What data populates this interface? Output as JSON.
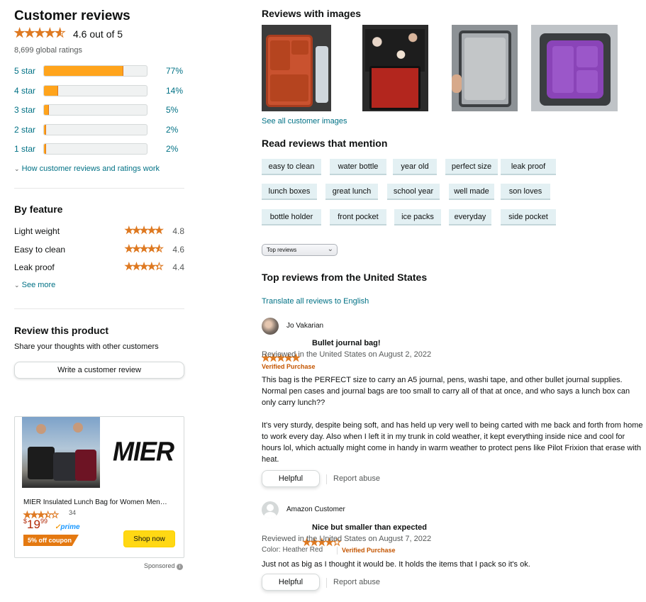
{
  "summary": {
    "title": "Customer reviews",
    "rating_text": "4.6 out of 5",
    "rating_value": 4.6,
    "global_ratings": "8,699 global ratings",
    "histogram": [
      {
        "label": "5 star",
        "percent_text": "77%",
        "percent": 77
      },
      {
        "label": "4 star",
        "percent_text": "14%",
        "percent": 14
      },
      {
        "label": "3 star",
        "percent_text": "5%",
        "percent": 5
      },
      {
        "label": "2 star",
        "percent_text": "2%",
        "percent": 2
      },
      {
        "label": "1 star",
        "percent_text": "2%",
        "percent": 2
      }
    ],
    "how_link": "How customer reviews and ratings work"
  },
  "features": {
    "title": "By feature",
    "items": [
      {
        "name": "Light weight",
        "rating": 4.8,
        "rating_text": "4.8"
      },
      {
        "name": "Easy to clean",
        "rating": 4.6,
        "rating_text": "4.6"
      },
      {
        "name": "Leak proof",
        "rating": 4.4,
        "rating_text": "4.4"
      }
    ],
    "see_more": "See more"
  },
  "review_cta": {
    "title": "Review this product",
    "subtitle": "Share your thoughts with other customers",
    "button": "Write a customer review"
  },
  "ad": {
    "brand": "MIER",
    "product": "MIER Insulated Lunch Bag for Women Men…",
    "rating": 3.5,
    "rating_count": "34",
    "price_symbol": "$",
    "price_whole": "19",
    "price_fraction": "99",
    "prime": "prime",
    "coupon": "5% off coupon",
    "button": "Shop now",
    "sponsored": "Sponsored"
  },
  "images": {
    "title": "Reviews with images",
    "see_all": "See all customer images"
  },
  "mentions": {
    "title": "Read reviews that mention",
    "chips": [
      "easy to clean",
      "water bottle",
      "year old",
      "perfect size",
      "leak proof",
      "lunch boxes",
      "great lunch",
      "school year",
      "well made",
      "son loves",
      "bottle holder",
      "front pocket",
      "ice packs",
      "everyday",
      "side pocket"
    ]
  },
  "sort": {
    "selected": "Top reviews"
  },
  "top_reviews": {
    "title": "Top reviews from the United States",
    "translate": "Translate all reviews to English"
  },
  "reviews": [
    {
      "author": "Jo Vakarian",
      "rating": 5,
      "title": "Bullet journal bag!",
      "meta": "Reviewed in the United States on August 2, 2022",
      "verified": "Verified Purchase",
      "body1": "This bag is the PERFECT size to carry an A5 journal, pens, washi tape, and other bullet journal supplies. Normal pen cases and journal bags are too small to carry all of that at once, and who says a lunch box can only carry lunch??",
      "body2": "It's very sturdy, despite being soft, and has held up very well to being carted with me back and forth from home to work every day. Also when I left it in my trunk in cold weather, it kept everything inside nice and cool for hours lol, which actually might come in handy in warm weather to protect pens like Pilot Frixion that erase with heat.",
      "helpful": "Helpful",
      "report": "Report abuse"
    },
    {
      "author": "Amazon Customer",
      "rating": 4,
      "title": "Nice but smaller than expected",
      "meta": "Reviewed in the United States on August 7, 2022",
      "color": "Color: Heather Red",
      "verified": "Verified Purchase",
      "body1": "Just not as big as I thought it would be. It holds the items that I pack so it's ok.",
      "helpful": "Helpful",
      "report": "Report abuse"
    }
  ],
  "colors": {
    "star": "#de7921",
    "bar": "#ffa41c",
    "link": "#007185",
    "verified": "#c45500",
    "price": "#b12704"
  }
}
